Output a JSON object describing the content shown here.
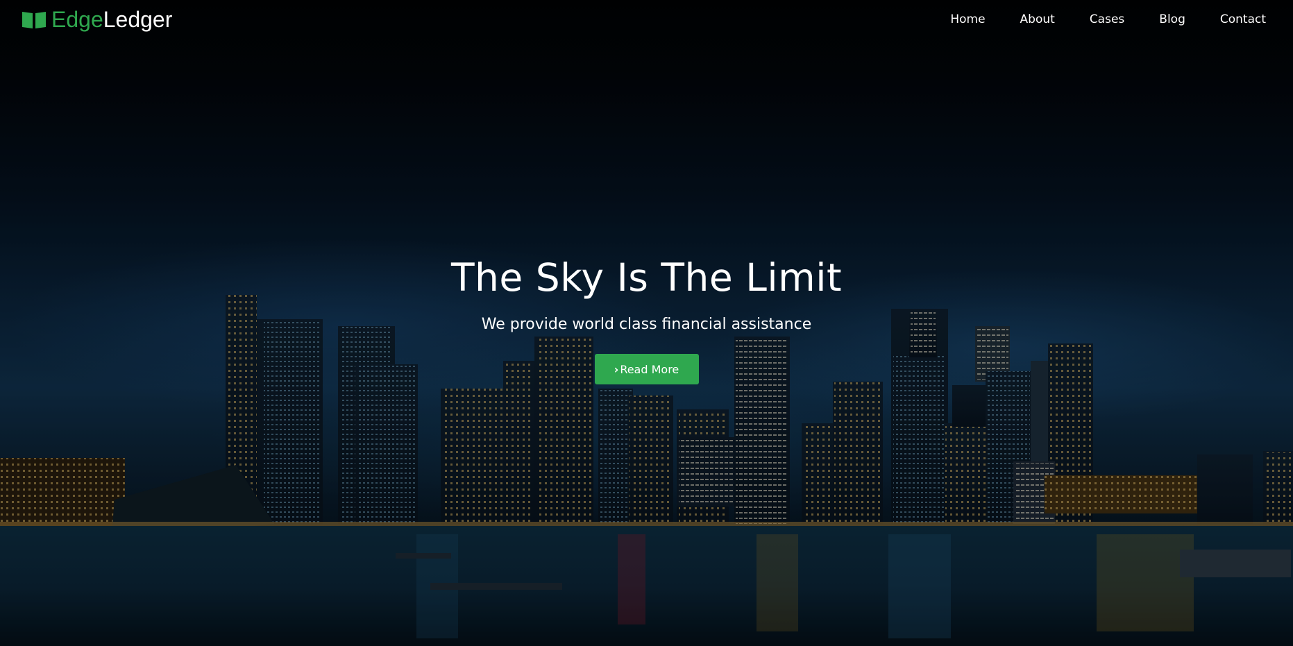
{
  "brand": {
    "name_part1": "Edge",
    "name_part2": "Ledger",
    "icon": "book-icon",
    "accent_color": "#2fa84f"
  },
  "nav": {
    "items": [
      {
        "label": "Home"
      },
      {
        "label": "About"
      },
      {
        "label": "Cases"
      },
      {
        "label": "Blog"
      },
      {
        "label": "Contact"
      }
    ]
  },
  "hero": {
    "title": "The Sky Is The Limit",
    "subtitle": "We provide world class financial assistance",
    "cta_label": "Read More",
    "cta_icon": "chevron-right-icon",
    "cta_color": "#2fa84f",
    "background": "night-city-skyline-image"
  }
}
